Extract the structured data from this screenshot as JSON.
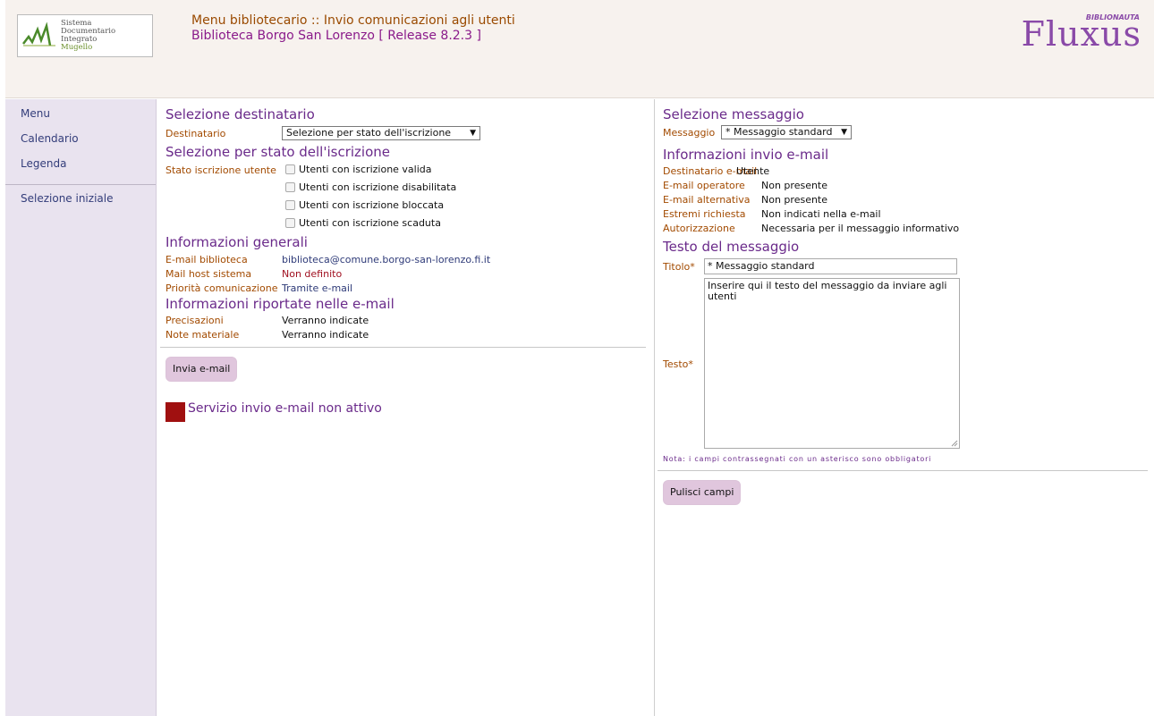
{
  "header": {
    "logo": {
      "lines": [
        "Sistema",
        "Documentario",
        "Integrato",
        "Mugello"
      ]
    },
    "title": "Menu bibliotecario :: Invio comunicazioni agli utenti",
    "subtitle": "Biblioteca Borgo San Lorenzo [ Release 8.2.3 ]",
    "brand": {
      "name": "Fluxus",
      "sub": "BIBLIONAUTA",
      "color": "#8a4aa8"
    }
  },
  "sidebar": {
    "items": [
      {
        "label": "Menu"
      },
      {
        "label": "Calendario"
      },
      {
        "label": "Legenda"
      }
    ],
    "after_sep": [
      {
        "label": "Selezione iniziale"
      }
    ]
  },
  "left": {
    "sec1_title": "Selezione destinatario",
    "destinatario_label": "Destinatario",
    "destinatario_value": "Selezione per stato dell'iscrizione",
    "sec2_title": "Selezione per stato dell'iscrizione",
    "stato_label": "Stato iscrizione utente",
    "checkboxes": [
      {
        "label": "Utenti con iscrizione valida"
      },
      {
        "label": "Utenti con iscrizione disabilitata"
      },
      {
        "label": "Utenti con iscrizione bloccata"
      },
      {
        "label": "Utenti con iscrizione scaduta"
      }
    ],
    "sec3_title": "Informazioni generali",
    "info": [
      {
        "label": "E-mail biblioteca",
        "value": "biblioteca@comune.borgo-san-lorenzo.fi.it"
      },
      {
        "label": "Mail host sistema",
        "value": "Non definito"
      },
      {
        "label": "Priorità comunicazione",
        "value": "Tramite e-mail"
      }
    ],
    "sec4_title": "Informazioni riportate nelle e-mail",
    "info2": [
      {
        "label": "Precisazioni",
        "value": "Verranno indicate"
      },
      {
        "label": "Note materiale",
        "value": "Verranno indicate"
      }
    ],
    "send_button": "Invia e-mail",
    "status_text": "Servizio invio e-mail non attivo",
    "status_color": "#a01010"
  },
  "right": {
    "sec1_title": "Selezione messaggio",
    "messaggio_label": "Messaggio",
    "messaggio_value": "* Messaggio standard",
    "sec2_title": "Informazioni invio e-mail",
    "info": [
      {
        "label": "Destinatario e-mail",
        "value": "Utente"
      },
      {
        "label": "E-mail operatore",
        "value": "Non presente"
      },
      {
        "label": "E-mail alternativa",
        "value": "Non presente"
      },
      {
        "label": "Estremi richiesta",
        "value": "Non indicati nella e-mail"
      },
      {
        "label": "Autorizzazione",
        "value": "Necessaria per il messaggio informativo"
      }
    ],
    "sec3_title": "Testo del messaggio",
    "titolo_label": "Titolo*",
    "titolo_value": "* Messaggio standard",
    "testo_label": "Testo*",
    "testo_value": "Inserire qui il testo del messaggio da inviare agli utenti",
    "note": "Nota: i campi contrassegnati con un asterisco sono obbligatori",
    "clear_button": "Pulisci campi"
  }
}
